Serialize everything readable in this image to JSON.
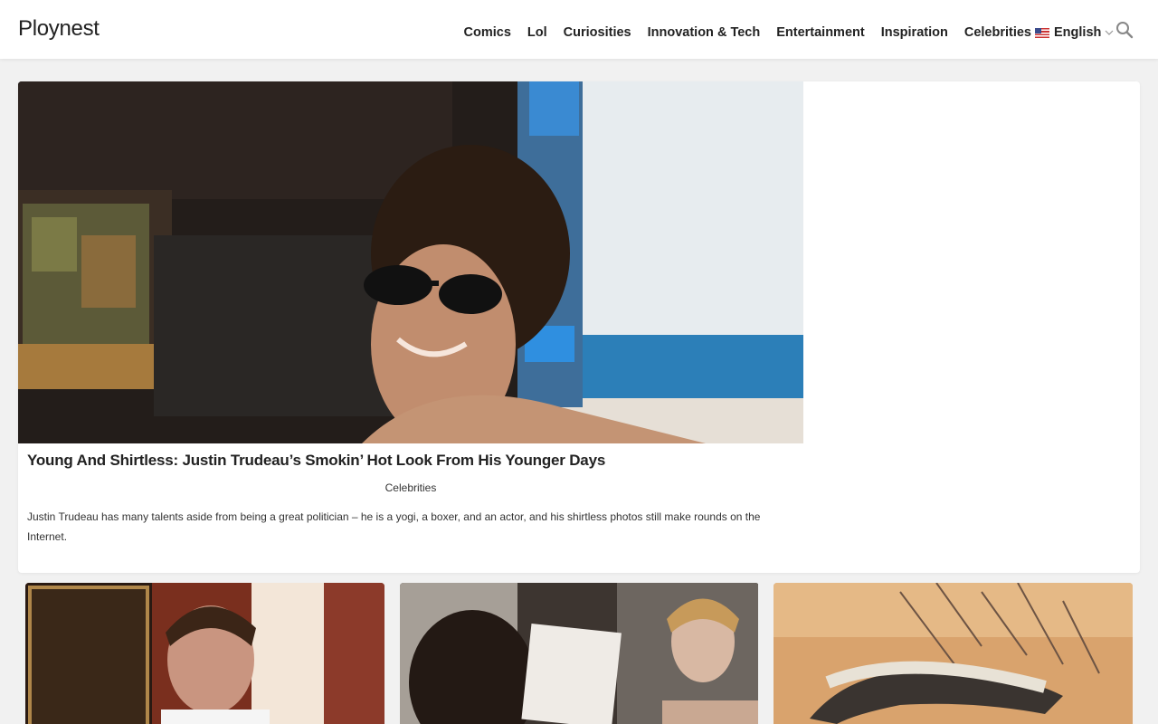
{
  "site": {
    "logo": "Ploynest"
  },
  "nav": {
    "items": [
      "Comics",
      "Lol",
      "Curiosities",
      "Innovation & Tech",
      "Entertainment",
      "Inspiration",
      "Celebrities"
    ],
    "language": "English"
  },
  "featured": {
    "title": "Young And Shirtless: Justin Trudeau’s Smokin’ Hot Look From His Younger Days",
    "category": "Celebrities",
    "description": "Justin Trudeau has many talents aside from being a great politician – he is a yogi, a boxer, and an actor, and his shirtless photos still make rounds on the Internet."
  },
  "colors": {
    "header_bg": "#ffffff",
    "page_bg": "#f1f1f1",
    "text": "#222222"
  }
}
